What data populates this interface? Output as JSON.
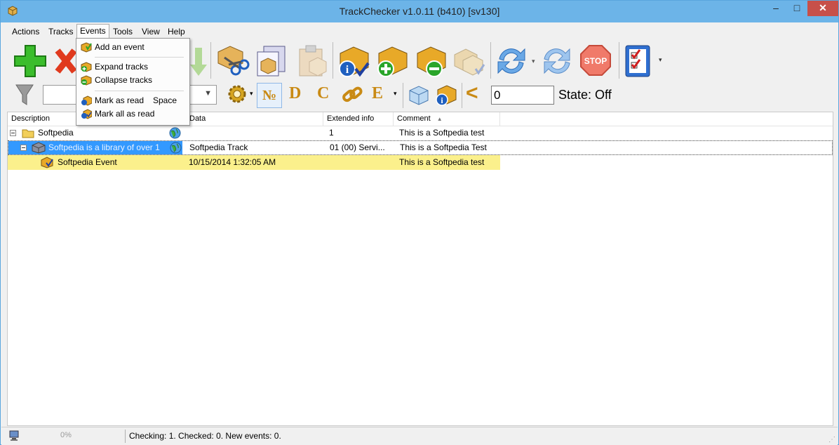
{
  "window": {
    "title": "TrackChecker v1.0.11 (b410)  [sv130]",
    "minimize": "–",
    "maximize": "□",
    "close": "✕"
  },
  "menubar": {
    "items": [
      "Actions",
      "Tracks",
      "Events",
      "Tools",
      "View",
      "Help"
    ]
  },
  "events_menu": {
    "items": [
      {
        "label": "Add an event",
        "shortcut": "",
        "icon": "add-event-icon"
      },
      {
        "label": "Expand tracks",
        "shortcut": "",
        "icon": "expand-icon"
      },
      {
        "label": "Collapse tracks",
        "shortcut": "",
        "icon": "collapse-icon"
      },
      {
        "label": "Mark as read",
        "shortcut": "Space",
        "icon": "mark-read-icon"
      },
      {
        "label": "Mark all as read",
        "shortcut": "",
        "icon": "mark-all-read-icon"
      }
    ]
  },
  "toolbar": {
    "letters": {
      "number": "№",
      "d": "D",
      "c": "C",
      "e": "E"
    },
    "less_than": "<",
    "number_value": "0",
    "state_label": "State: Off",
    "stop_label": "STOP"
  },
  "grid": {
    "columns": [
      "Description",
      "Data",
      "Extended info",
      "Comment"
    ],
    "sort_indicator": "▲",
    "rows": [
      {
        "description": "Softpedia",
        "data": "",
        "extended": "1",
        "comment": "This is a Softpedia test"
      },
      {
        "description": "Softpedia is a library of over 1",
        "data": "Softpedia Track",
        "extended": "01 (00) Servi...",
        "comment": "This is a Softpedia Test"
      },
      {
        "description": "Softpedia Event",
        "data": "10/15/2014 1:32:05 AM",
        "extended": "",
        "comment": "This is a Softpedia test"
      }
    ]
  },
  "status": {
    "text": "Checking: 1. Checked: 0. New events: 0.",
    "progress": "0%"
  },
  "colors": {
    "titlebar": "#6cb4e8",
    "event_row": "#fbf08c",
    "selected_row_text": "#ffffff",
    "close_button": "#c7504a"
  }
}
